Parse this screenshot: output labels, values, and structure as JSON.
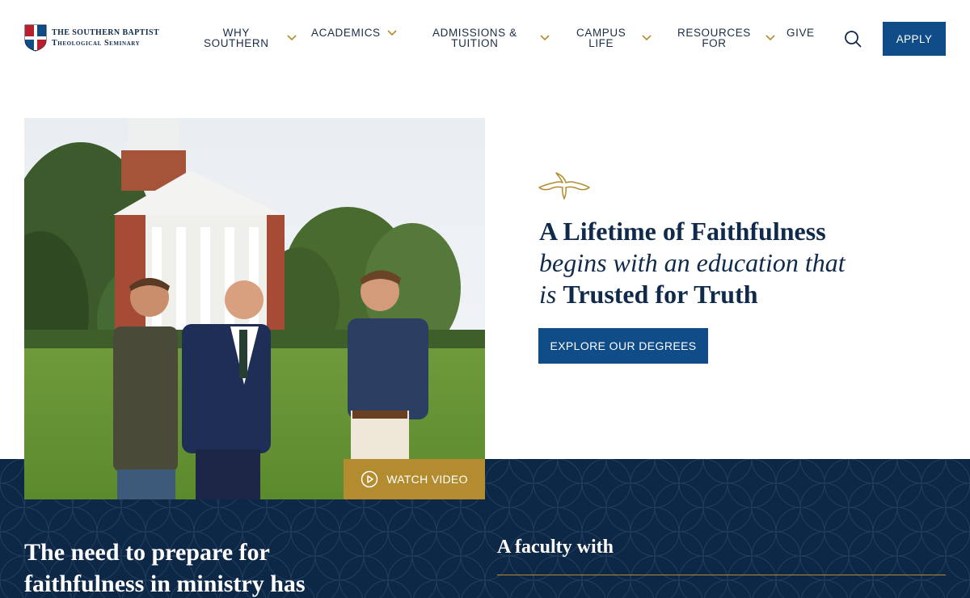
{
  "brand": {
    "line1": "THE SOUTHERN BAPTIST",
    "line2": "Theological Seminary",
    "colors": {
      "navy": "#0d2747",
      "blue": "#0f4c88",
      "gold": "#b38c2f"
    }
  },
  "nav": {
    "items": [
      {
        "label": "WHY\nSOUTHERN",
        "icon": "chevron-down-icon"
      },
      {
        "label": "ACADEMICS",
        "icon": "chevron-down-icon"
      },
      {
        "label": "ADMISSIONS &\nTUITION",
        "icon": "chevron-down-icon"
      },
      {
        "label": "CAMPUS\nLIFE",
        "icon": "chevron-down-icon"
      },
      {
        "label": "RESOURCES\nFOR",
        "icon": "chevron-down-icon"
      },
      {
        "label": "GIVE"
      }
    ],
    "search_icon": "search-icon",
    "apply_label": "APPLY"
  },
  "hero": {
    "watch_label": "WATCH VIDEO",
    "headline_line1": "A Lifetime of Faithfulness",
    "headline_line2": "begins with an education that",
    "headline_line3_italic": "is",
    "headline_line3_bold": "Trusted for Truth",
    "cta_label": "EXPLORE OUR DEGREES",
    "ornament_icon": "dove-icon"
  },
  "section": {
    "left_title": "The need to prepare for\nfaithfulness in ministry has",
    "right_title": "A faculty with"
  }
}
